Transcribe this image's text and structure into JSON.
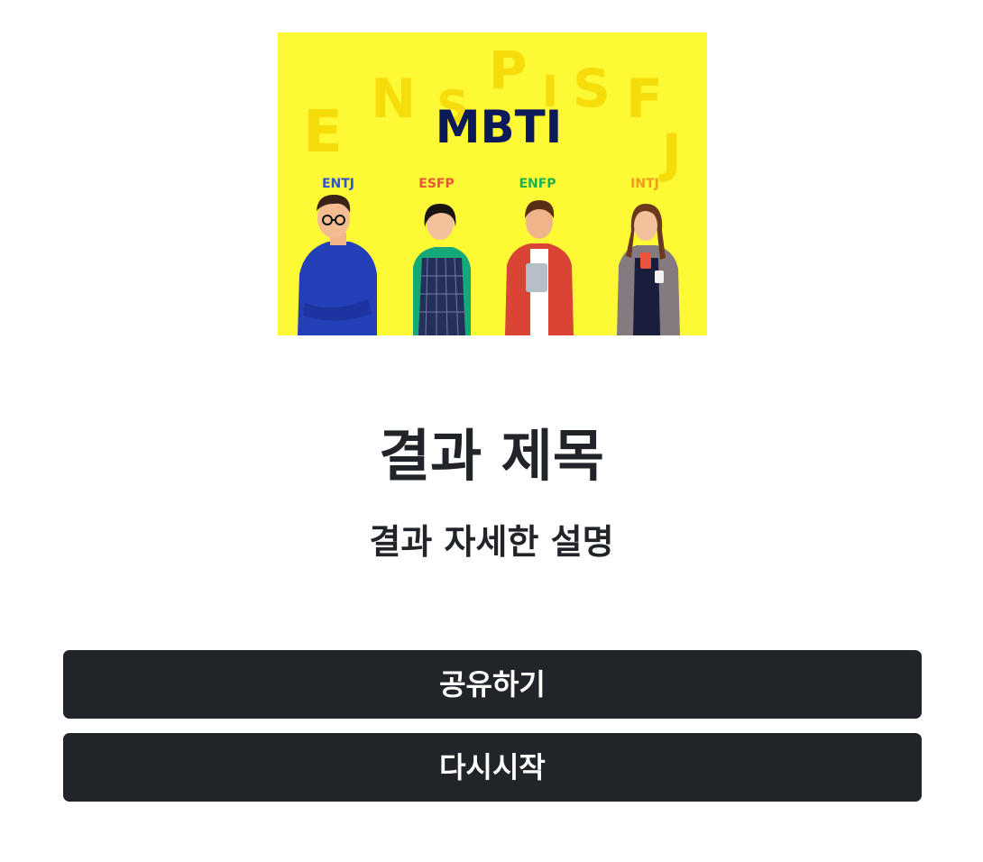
{
  "hero": {
    "logo_text": "MBTI",
    "background_letters": [
      "E",
      "N",
      "S",
      "P",
      "I",
      "S",
      "F",
      "J"
    ],
    "people": [
      {
        "type": "ENTJ",
        "color": "#2f55c8"
      },
      {
        "type": "ESFP",
        "color": "#e8553b"
      },
      {
        "type": "ENFP",
        "color": "#22b24c"
      },
      {
        "type": "INTJ",
        "color": "#f29a1f"
      }
    ],
    "colors": {
      "background": "#fef935",
      "letters": "#f6dc0a",
      "logo": "#0d1a5a"
    }
  },
  "result": {
    "title": "결과 제목",
    "description": "결과 자세한 설명"
  },
  "buttons": {
    "share_label": "공유하기",
    "restart_label": "다시시작"
  },
  "colors": {
    "button_bg": "#212529",
    "button_text": "#ffffff",
    "text": "#212529"
  }
}
